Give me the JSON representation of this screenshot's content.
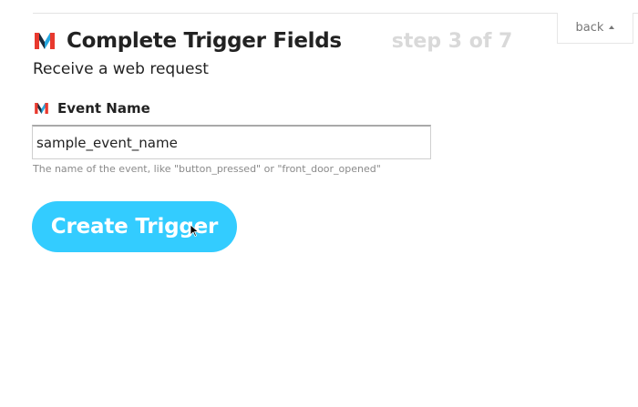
{
  "header": {
    "title": "Complete Trigger Fields",
    "step": "step 3 of 7",
    "logo_icon": "maker-logo-icon"
  },
  "back_button": {
    "label": "back",
    "icon": "caret-up-icon"
  },
  "subtitle": "Receive a web request",
  "field": {
    "label": "Event Name",
    "value": "sample_event_name",
    "helper": "The name of the event, like \"button_pressed\" or \"front_door_opened\"",
    "icon": "maker-logo-icon"
  },
  "submit": {
    "label": "Create Trigger"
  },
  "colors": {
    "accent": "#33ccff",
    "logo_red": "#e8392e",
    "logo_blue": "#27a9e1",
    "logo_dark": "#1a2a3a",
    "step_gray": "#d9d9d9"
  }
}
